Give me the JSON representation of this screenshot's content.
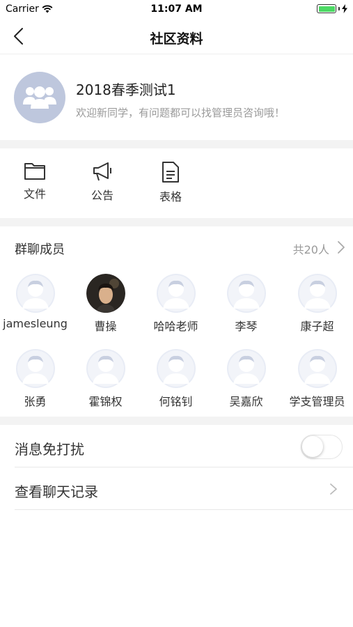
{
  "status_bar": {
    "carrier": "Carrier",
    "time": "11:07 AM",
    "battery_level": 1.0
  },
  "nav": {
    "title": "社区资料"
  },
  "group": {
    "name": "2018春季测试1",
    "description": "欢迎新同学，有问题都可以找管理员咨询哦！"
  },
  "tools": [
    {
      "label": "文件",
      "icon": "folder-icon"
    },
    {
      "label": "公告",
      "icon": "megaphone-icon"
    },
    {
      "label": "表格",
      "icon": "document-icon"
    }
  ],
  "members": {
    "title": "群聊成员",
    "count": "共20人",
    "list": [
      {
        "name": "jamesleung",
        "photo": false
      },
      {
        "name": "曹操",
        "photo": true
      },
      {
        "name": "哈哈老师",
        "photo": false
      },
      {
        "name": "李琴",
        "photo": false
      },
      {
        "name": "康子超",
        "photo": false
      },
      {
        "name": "张勇",
        "photo": false
      },
      {
        "name": "霍锦权",
        "photo": false
      },
      {
        "name": "何铭钊",
        "photo": false
      },
      {
        "name": "吴嘉欣",
        "photo": false
      },
      {
        "name": "学支管理员",
        "photo": false
      }
    ]
  },
  "settings": {
    "mute_label": "消息免打扰",
    "mute_enabled": false,
    "history_label": "查看聊天记录"
  },
  "colors": {
    "avatar_bg": "#bec7dd",
    "placeholder_avatar": "#e8ecf5",
    "battery": "#4cd964",
    "section_gap": "#f3f3f3"
  }
}
